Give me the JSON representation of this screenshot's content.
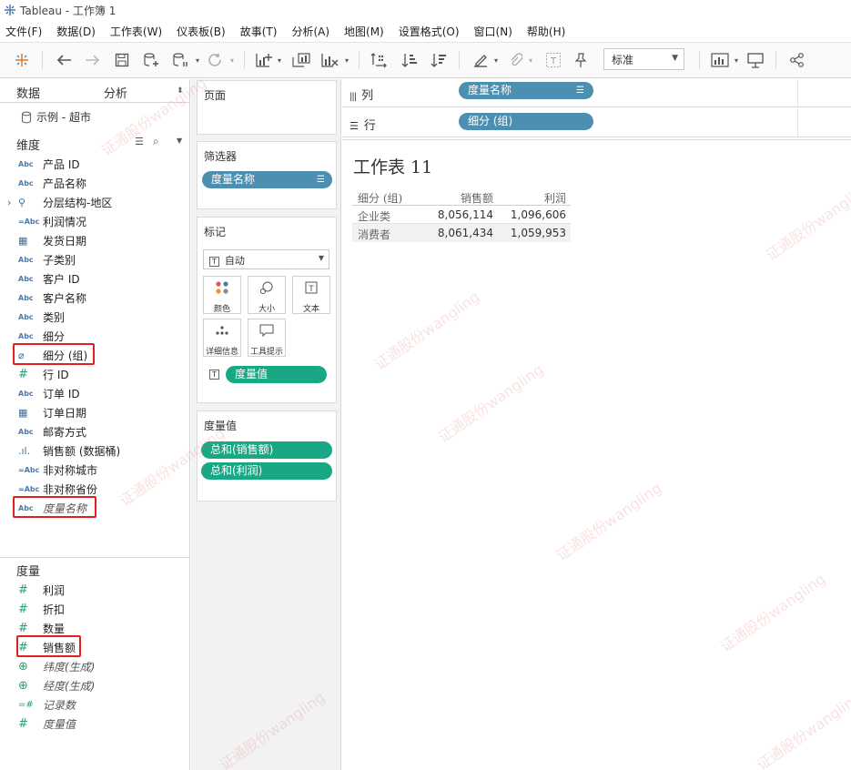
{
  "window": {
    "title": "Tableau - 工作簿 1"
  },
  "menu": [
    "文件(F)",
    "数据(D)",
    "工作表(W)",
    "仪表板(B)",
    "故事(T)",
    "分析(A)",
    "地图(M)",
    "设置格式(O)",
    "窗口(N)",
    "帮助(H)"
  ],
  "toolbar": {
    "fit_select": "标准"
  },
  "left_panel": {
    "tabs": {
      "data": "数据",
      "analysis": "分析"
    },
    "datasource": "示例 - 超市",
    "dimensions_header": "维度",
    "dimensions": [
      {
        "icon": "Abc",
        "label": "产品 ID"
      },
      {
        "icon": "Abc",
        "label": "产品名称"
      },
      {
        "icon": "hierarchy",
        "label": "分层结构-地区"
      },
      {
        "icon": "=Abc",
        "label": "利润情况"
      },
      {
        "icon": "calendar",
        "label": "发货日期"
      },
      {
        "icon": "Abc",
        "label": "子类别"
      },
      {
        "icon": "Abc",
        "label": "客户 ID"
      },
      {
        "icon": "Abc",
        "label": "客户名称"
      },
      {
        "icon": "Abc",
        "label": "类别"
      },
      {
        "icon": "Abc",
        "label": "细分"
      },
      {
        "icon": "paperclip",
        "label": "细分 (组)"
      },
      {
        "icon": "#",
        "label": "行 ID"
      },
      {
        "icon": "Abc",
        "label": "订单 ID"
      },
      {
        "icon": "calendar",
        "label": "订单日期"
      },
      {
        "icon": "Abc",
        "label": "邮寄方式"
      },
      {
        "icon": "bins",
        "label": "销售额 (数据桶)"
      },
      {
        "icon": "=Abc",
        "label": "非对称城市"
      },
      {
        "icon": "=Abc",
        "label": "非对称省份"
      },
      {
        "icon": "Abc",
        "label": "度量名称"
      }
    ],
    "measures_header": "度量",
    "measures": [
      {
        "icon": "#",
        "label": "利润"
      },
      {
        "icon": "#",
        "label": "折扣"
      },
      {
        "icon": "#",
        "label": "数量"
      },
      {
        "icon": "#",
        "label": "销售额"
      },
      {
        "icon": "globe",
        "label": "纬度(生成)"
      },
      {
        "icon": "globe",
        "label": "经度(生成)"
      },
      {
        "icon": "=#",
        "label": "记录数"
      },
      {
        "icon": "#",
        "label": "度量值"
      }
    ]
  },
  "cards": {
    "pages": "页面",
    "filters": "筛选器",
    "filter_pill": "度量名称",
    "marks": "标记",
    "marks_type": "自动",
    "marks_buttons": [
      "颜色",
      "大小",
      "文本",
      "详细信息",
      "工具提示"
    ],
    "marks_pill": "度量值",
    "measure_values": "度量值",
    "measure_values_pills": [
      "总和(销售额)",
      "总和(利润)"
    ]
  },
  "shelves": {
    "columns_label": "列",
    "columns_pill": "度量名称",
    "rows_label": "行",
    "rows_pill": "细分 (组)"
  },
  "sheet": {
    "title": "工作表 11",
    "headers": [
      "细分 (组)",
      "销售额",
      "利润"
    ],
    "rows": [
      [
        "企业类",
        "8,056,114",
        "1,096,606"
      ],
      [
        "消费者",
        "8,061,434",
        "1,059,953"
      ]
    ]
  },
  "watermark": "证通股份wangling",
  "colors": {
    "red_highlight": "#e02020",
    "pill_blue": "#4d8fb0",
    "pill_green": "#19a885"
  }
}
